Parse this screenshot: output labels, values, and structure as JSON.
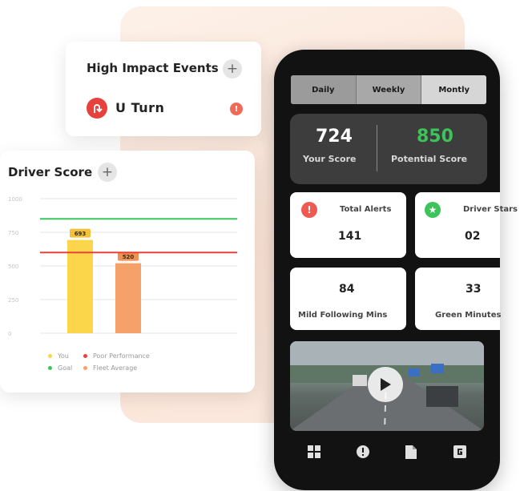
{
  "high_impact": {
    "title": "High Impact Events",
    "event_label": "U Turn",
    "alert_badge": "!"
  },
  "driver_score": {
    "title": "Driver Score",
    "legend": [
      "You",
      "Poor Performance",
      "Goal",
      "Fleet Average"
    ]
  },
  "chart_data": {
    "type": "bar",
    "categories": [
      "You",
      "Fleet Average"
    ],
    "values": [
      693,
      520
    ],
    "ylim": [
      0,
      1000
    ],
    "yticks": [
      "1000",
      "750",
      "500",
      "250",
      "0"
    ],
    "reference_lines": [
      {
        "name": "Goal",
        "value": 850,
        "color": "#3cc45a"
      },
      {
        "name": "Poor Performance",
        "value": 600,
        "color": "#e8413c"
      }
    ],
    "bar_colors": [
      "#fbd54a",
      "#f6a06a"
    ],
    "data_labels": [
      "693",
      "520"
    ],
    "legend_colors": [
      "#fbd54a",
      "#e8413c",
      "#3cc45a",
      "#f6a06a"
    ],
    "grid": true
  },
  "phone": {
    "tabs": [
      "Daily",
      "Weekly",
      "Montly"
    ],
    "your_score": {
      "value": "724",
      "label": "Your Score"
    },
    "potential_score": {
      "value": "850",
      "label": "Potential Score",
      "color": "#3cc45a"
    },
    "tiles": {
      "total_alerts": {
        "label": "Total Alerts",
        "value": "141",
        "icon": "alert-icon"
      },
      "driver_stars": {
        "label": "Driver Stars",
        "value": "02",
        "icon": "star-icon"
      },
      "mild_following": {
        "label": "Mild Following Mins",
        "value": "84"
      },
      "green_minutes": {
        "label": "Green Minutes",
        "value": "33"
      }
    },
    "nav_icons": [
      "grid-icon",
      "alert-icon",
      "document-icon",
      "g-icon"
    ]
  }
}
